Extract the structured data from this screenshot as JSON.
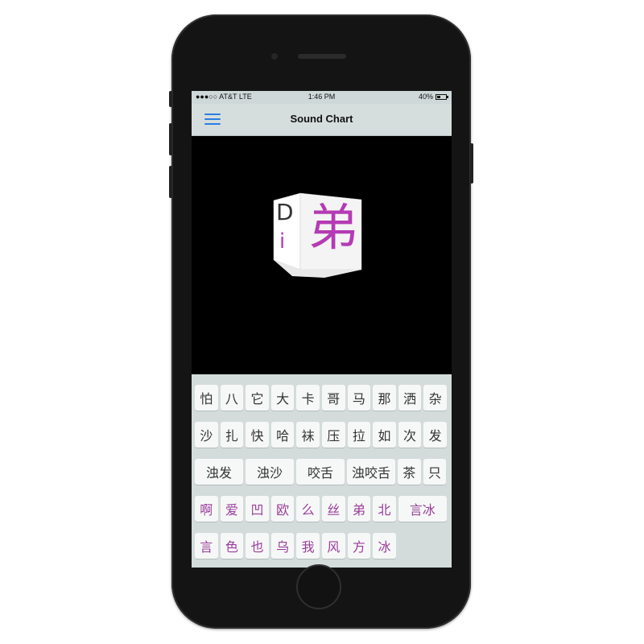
{
  "status_bar": {
    "carrier": "●●●○○ AT&T  LTE",
    "time": "1:46 PM",
    "battery_text": "40%",
    "battery_level_percent": 40
  },
  "nav": {
    "title": "Sound Chart",
    "menu_icon": "hamburger-menu-icon",
    "accent_color": "#2b7de0"
  },
  "display_cube": {
    "initial": "D",
    "final": "i",
    "character": "弟",
    "character_color": "#b43bb4"
  },
  "keyboard": {
    "rows": [
      [
        {
          "label": "怕"
        },
        {
          "label": "八"
        },
        {
          "label": "它"
        },
        {
          "label": "大"
        },
        {
          "label": "卡"
        },
        {
          "label": "哥"
        },
        {
          "label": "马"
        },
        {
          "label": "那"
        },
        {
          "label": "洒"
        },
        {
          "label": "杂"
        }
      ],
      [
        {
          "label": "沙"
        },
        {
          "label": "扎"
        },
        {
          "label": "快"
        },
        {
          "label": "哈"
        },
        {
          "label": "袜"
        },
        {
          "label": "压"
        },
        {
          "label": "拉"
        },
        {
          "label": "如"
        },
        {
          "label": "次"
        },
        {
          "label": "发"
        }
      ],
      [
        {
          "label": "浊发",
          "wide": true
        },
        {
          "label": "浊沙",
          "wide": true
        },
        {
          "label": "咬舌",
          "wide": true
        },
        {
          "label": "浊咬舌",
          "wide": true
        },
        {
          "label": "茶"
        },
        {
          "label": "只"
        }
      ],
      [
        {
          "label": "啊",
          "purple": true
        },
        {
          "label": "爱",
          "purple": true
        },
        {
          "label": "凹",
          "purple": true
        },
        {
          "label": "欧",
          "purple": true
        },
        {
          "label": "么",
          "purple": true
        },
        {
          "label": "丝",
          "purple": true
        },
        {
          "label": "弟",
          "purple": true
        },
        {
          "label": "北",
          "purple": true
        },
        {
          "label": "言冰",
          "wide": true,
          "purple": true
        }
      ],
      [
        {
          "label": "言",
          "purple": true
        },
        {
          "label": "色",
          "purple": true
        },
        {
          "label": "也",
          "purple": true
        },
        {
          "label": "乌",
          "purple": true
        },
        {
          "label": "我",
          "purple": true
        },
        {
          "label": "风",
          "purple": true
        },
        {
          "label": "方",
          "purple": true
        },
        {
          "label": "冰",
          "purple": true
        }
      ]
    ]
  }
}
